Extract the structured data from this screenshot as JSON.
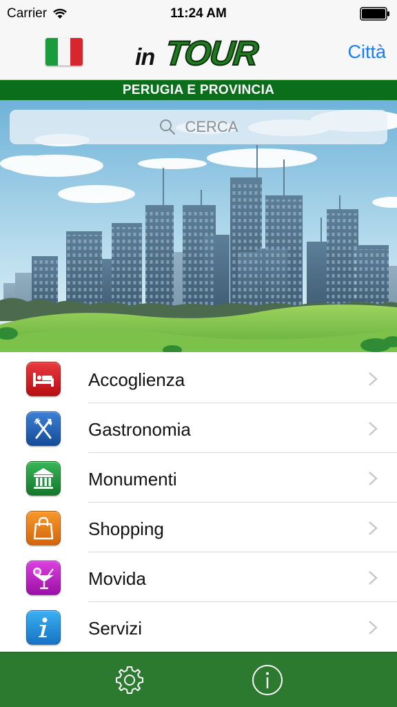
{
  "status_bar": {
    "carrier": "Carrier",
    "time": "11:24 AM",
    "wifi_icon": "wifi-icon",
    "battery_icon": "battery-icon"
  },
  "nav_bar": {
    "flag_icon": "italian-flag-icon",
    "logo_text_in": "in",
    "logo_text_tour": "TOUR",
    "city_button_label": "Città"
  },
  "region_banner": {
    "text": "PERUGIA E PROVINCIA",
    "color": "#0b6e1a"
  },
  "search": {
    "placeholder": "CERCA",
    "icon": "search-icon"
  },
  "menu": {
    "items": [
      {
        "label": "Accoglienza",
        "icon": "bed-icon",
        "color": "#d0141b"
      },
      {
        "label": "Gastronomia",
        "icon": "fork-knife-icon",
        "color": "#1f5fb8"
      },
      {
        "label": "Monumenti",
        "icon": "monument-icon",
        "color": "#1c9a3a"
      },
      {
        "label": "Shopping",
        "icon": "shopping-bag-icon",
        "color": "#ef7d10"
      },
      {
        "label": "Movida",
        "icon": "cocktail-icon",
        "color": "#c21cc9"
      },
      {
        "label": "Servizi",
        "icon": "info-icon",
        "color": "#1c8fe0"
      }
    ]
  },
  "tab_bar": {
    "color": "#2c7a30",
    "items": [
      {
        "icon": "gear-icon"
      },
      {
        "icon": "info-circle-icon"
      }
    ]
  }
}
